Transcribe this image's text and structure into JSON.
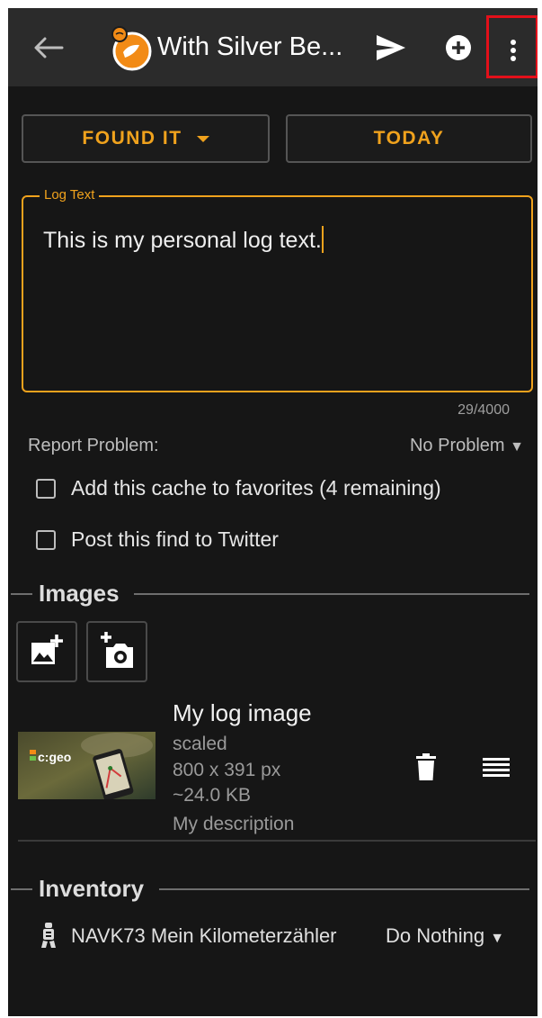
{
  "appbar": {
    "title": "With Silver Be...",
    "icons": [
      "back-arrow-icon",
      "cache-type-icon",
      "send-icon",
      "add-circle-icon",
      "more-vert-icon"
    ],
    "highlight_color": "#e3101a"
  },
  "actions": {
    "log_type": "FOUND IT",
    "date": "TODAY",
    "accent_color": "#f0a21d"
  },
  "log": {
    "label": "Log Text",
    "text": "This is my personal log text.",
    "counter": "29/4000"
  },
  "report": {
    "label": "Report Problem:",
    "value": "No Problem",
    "arrow": "▼"
  },
  "options": {
    "favorites_label": "Add this cache to favorites (4 remaining)",
    "favorites_checked": false,
    "twitter_label": "Post this find to Twitter",
    "twitter_checked": false
  },
  "images": {
    "section_title": "Images",
    "add_buttons": [
      "add-photo-icon",
      "camera-add-icon"
    ],
    "items": [
      {
        "title": "My log image",
        "state": "scaled",
        "dimensions": "800 x 391 px",
        "size": "~24.0 KB",
        "description": "My description",
        "thumb_text": "c:geo"
      }
    ]
  },
  "inventory": {
    "section_title": "Inventory",
    "items": [
      {
        "code": "NAVK73",
        "name": "Mein Kilometerzähler",
        "action": "Do Nothing",
        "arrow": "▼"
      }
    ]
  }
}
